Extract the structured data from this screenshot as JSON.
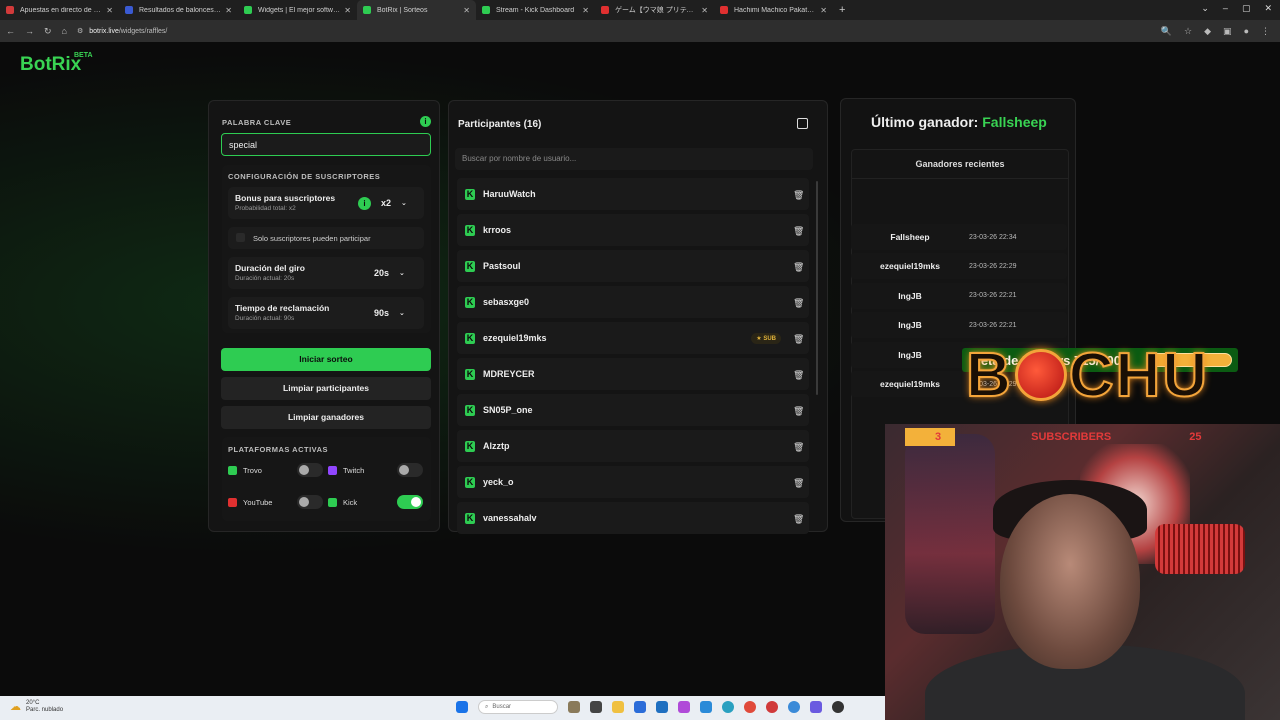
{
  "browser": {
    "tabs": [
      {
        "label": "Apuestas en directo de Basquet",
        "color": "#d23a3a",
        "active": false
      },
      {
        "label": "Resultados de baloncesto en di",
        "color": "#3a5ad2",
        "active": false
      },
      {
        "label": "Widgets | El mejor software pa",
        "color": "#2ecc52",
        "active": false
      },
      {
        "label": "BotRix | Sorteos",
        "color": "#2ecc52",
        "active": true
      },
      {
        "label": "Stream - Kick Dashboard",
        "color": "#2ecc52",
        "active": false
      },
      {
        "label": "ゲーム【ウマ娘 プリティーダービ",
        "color": "#e03030",
        "active": false
      },
      {
        "label": "Hachimi Machico Pakatube - Y",
        "color": "#e03030",
        "active": false
      }
    ],
    "url_domain": "botrix.live",
    "url_path": "/widgets/raffles/"
  },
  "logo": {
    "name": "BotRix",
    "badge": "BETA"
  },
  "settings": {
    "keyword_label": "PALABRA CLAVE",
    "keyword_value": "special",
    "subs_config_label": "CONFIGURACIÓN DE SUSCRIPTORES",
    "bonus_title": "Bonus para suscriptores",
    "bonus_sub": "Probabilidad total: x2",
    "bonus_value": "x2",
    "subs_only_label": "Solo suscriptores pueden participar",
    "spin_title": "Duración del giro",
    "spin_sub": "Duración actual: 20s",
    "spin_value": "20s",
    "claim_title": "Tiempo de reclamación",
    "claim_sub": "Duración actual: 90s",
    "claim_value": "90s",
    "start_button": "Iniciar sorteo",
    "clear_participants_button": "Limpiar participantes",
    "clear_winners_button": "Limpiar ganadores",
    "platforms_label": "PLATAFORMAS ACTIVAS",
    "platforms": [
      {
        "name": "Trovo",
        "on": false,
        "color": "#2ecc52"
      },
      {
        "name": "Twitch",
        "on": false,
        "color": "#9146ff"
      },
      {
        "name": "YouTube",
        "on": false,
        "color": "#e03030"
      },
      {
        "name": "Kick",
        "on": true,
        "color": "#2ecc52"
      }
    ]
  },
  "participants": {
    "title": "Participantes (16)",
    "search_placeholder": "Buscar por nombre de usuario...",
    "sub_badge": "SUB",
    "list": [
      {
        "name": "HaruuWatch",
        "sub": false
      },
      {
        "name": "krroos",
        "sub": false
      },
      {
        "name": "Pastsoul",
        "sub": false
      },
      {
        "name": "sebasxge0",
        "sub": false
      },
      {
        "name": "ezequiel19mks",
        "sub": true
      },
      {
        "name": "MDREYCER",
        "sub": false
      },
      {
        "name": "SN05P_one",
        "sub": false
      },
      {
        "name": "Alzztp",
        "sub": false
      },
      {
        "name": "yeck_o",
        "sub": false
      },
      {
        "name": "vanessahalv",
        "sub": false
      }
    ]
  },
  "winners": {
    "last_label": "Último ganador:",
    "last_name": "Fallsheep",
    "recent_title": "Ganadores recientes",
    "list": [
      {
        "name": "Fallsheep",
        "date": "23-03-26 22:34"
      },
      {
        "name": "ezequiel19mks",
        "date": "23-03-26 22:29"
      },
      {
        "name": "IngJB",
        "date": "23-03-26 22:21"
      },
      {
        "name": "IngJB",
        "date": "23-03-26 22:21"
      },
      {
        "name": "IngJB",
        "date": "2"
      },
      {
        "name": "ezequiel19mks",
        "date": "23-03-26 22:29"
      }
    ]
  },
  "overlay": {
    "follows_text": "Meta de Follows 715/500",
    "follows_progress": 1.0,
    "brand_text": "BOCHU",
    "subs_count": "3",
    "subs_label": "SUBSCRIBERS",
    "subs_goal": "25"
  },
  "taskbar": {
    "temperature": "20°C",
    "weather": "Parc. nublado",
    "search_placeholder": "Buscar"
  }
}
